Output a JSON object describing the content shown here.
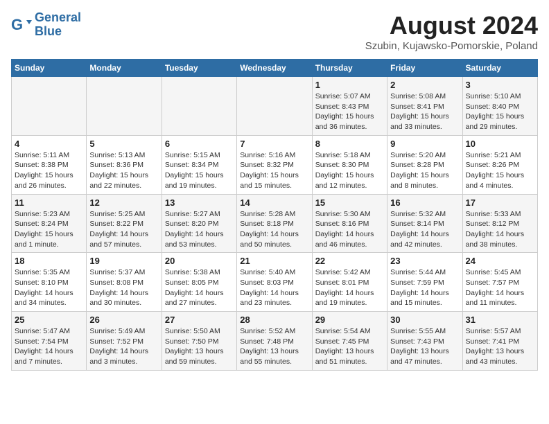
{
  "header": {
    "logo_line1": "General",
    "logo_line2": "Blue",
    "month_year": "August 2024",
    "location": "Szubin, Kujawsko-Pomorskie, Poland"
  },
  "weekdays": [
    "Sunday",
    "Monday",
    "Tuesday",
    "Wednesday",
    "Thursday",
    "Friday",
    "Saturday"
  ],
  "weeks": [
    [
      {
        "day": "",
        "info": ""
      },
      {
        "day": "",
        "info": ""
      },
      {
        "day": "",
        "info": ""
      },
      {
        "day": "",
        "info": ""
      },
      {
        "day": "1",
        "info": "Sunrise: 5:07 AM\nSunset: 8:43 PM\nDaylight: 15 hours\nand 36 minutes."
      },
      {
        "day": "2",
        "info": "Sunrise: 5:08 AM\nSunset: 8:41 PM\nDaylight: 15 hours\nand 33 minutes."
      },
      {
        "day": "3",
        "info": "Sunrise: 5:10 AM\nSunset: 8:40 PM\nDaylight: 15 hours\nand 29 minutes."
      }
    ],
    [
      {
        "day": "4",
        "info": "Sunrise: 5:11 AM\nSunset: 8:38 PM\nDaylight: 15 hours\nand 26 minutes."
      },
      {
        "day": "5",
        "info": "Sunrise: 5:13 AM\nSunset: 8:36 PM\nDaylight: 15 hours\nand 22 minutes."
      },
      {
        "day": "6",
        "info": "Sunrise: 5:15 AM\nSunset: 8:34 PM\nDaylight: 15 hours\nand 19 minutes."
      },
      {
        "day": "7",
        "info": "Sunrise: 5:16 AM\nSunset: 8:32 PM\nDaylight: 15 hours\nand 15 minutes."
      },
      {
        "day": "8",
        "info": "Sunrise: 5:18 AM\nSunset: 8:30 PM\nDaylight: 15 hours\nand 12 minutes."
      },
      {
        "day": "9",
        "info": "Sunrise: 5:20 AM\nSunset: 8:28 PM\nDaylight: 15 hours\nand 8 minutes."
      },
      {
        "day": "10",
        "info": "Sunrise: 5:21 AM\nSunset: 8:26 PM\nDaylight: 15 hours\nand 4 minutes."
      }
    ],
    [
      {
        "day": "11",
        "info": "Sunrise: 5:23 AM\nSunset: 8:24 PM\nDaylight: 15 hours\nand 1 minute."
      },
      {
        "day": "12",
        "info": "Sunrise: 5:25 AM\nSunset: 8:22 PM\nDaylight: 14 hours\nand 57 minutes."
      },
      {
        "day": "13",
        "info": "Sunrise: 5:27 AM\nSunset: 8:20 PM\nDaylight: 14 hours\nand 53 minutes."
      },
      {
        "day": "14",
        "info": "Sunrise: 5:28 AM\nSunset: 8:18 PM\nDaylight: 14 hours\nand 50 minutes."
      },
      {
        "day": "15",
        "info": "Sunrise: 5:30 AM\nSunset: 8:16 PM\nDaylight: 14 hours\nand 46 minutes."
      },
      {
        "day": "16",
        "info": "Sunrise: 5:32 AM\nSunset: 8:14 PM\nDaylight: 14 hours\nand 42 minutes."
      },
      {
        "day": "17",
        "info": "Sunrise: 5:33 AM\nSunset: 8:12 PM\nDaylight: 14 hours\nand 38 minutes."
      }
    ],
    [
      {
        "day": "18",
        "info": "Sunrise: 5:35 AM\nSunset: 8:10 PM\nDaylight: 14 hours\nand 34 minutes."
      },
      {
        "day": "19",
        "info": "Sunrise: 5:37 AM\nSunset: 8:08 PM\nDaylight: 14 hours\nand 30 minutes."
      },
      {
        "day": "20",
        "info": "Sunrise: 5:38 AM\nSunset: 8:05 PM\nDaylight: 14 hours\nand 27 minutes."
      },
      {
        "day": "21",
        "info": "Sunrise: 5:40 AM\nSunset: 8:03 PM\nDaylight: 14 hours\nand 23 minutes."
      },
      {
        "day": "22",
        "info": "Sunrise: 5:42 AM\nSunset: 8:01 PM\nDaylight: 14 hours\nand 19 minutes."
      },
      {
        "day": "23",
        "info": "Sunrise: 5:44 AM\nSunset: 7:59 PM\nDaylight: 14 hours\nand 15 minutes."
      },
      {
        "day": "24",
        "info": "Sunrise: 5:45 AM\nSunset: 7:57 PM\nDaylight: 14 hours\nand 11 minutes."
      }
    ],
    [
      {
        "day": "25",
        "info": "Sunrise: 5:47 AM\nSunset: 7:54 PM\nDaylight: 14 hours\nand 7 minutes."
      },
      {
        "day": "26",
        "info": "Sunrise: 5:49 AM\nSunset: 7:52 PM\nDaylight: 14 hours\nand 3 minutes."
      },
      {
        "day": "27",
        "info": "Sunrise: 5:50 AM\nSunset: 7:50 PM\nDaylight: 13 hours\nand 59 minutes."
      },
      {
        "day": "28",
        "info": "Sunrise: 5:52 AM\nSunset: 7:48 PM\nDaylight: 13 hours\nand 55 minutes."
      },
      {
        "day": "29",
        "info": "Sunrise: 5:54 AM\nSunset: 7:45 PM\nDaylight: 13 hours\nand 51 minutes."
      },
      {
        "day": "30",
        "info": "Sunrise: 5:55 AM\nSunset: 7:43 PM\nDaylight: 13 hours\nand 47 minutes."
      },
      {
        "day": "31",
        "info": "Sunrise: 5:57 AM\nSunset: 7:41 PM\nDaylight: 13 hours\nand 43 minutes."
      }
    ]
  ]
}
